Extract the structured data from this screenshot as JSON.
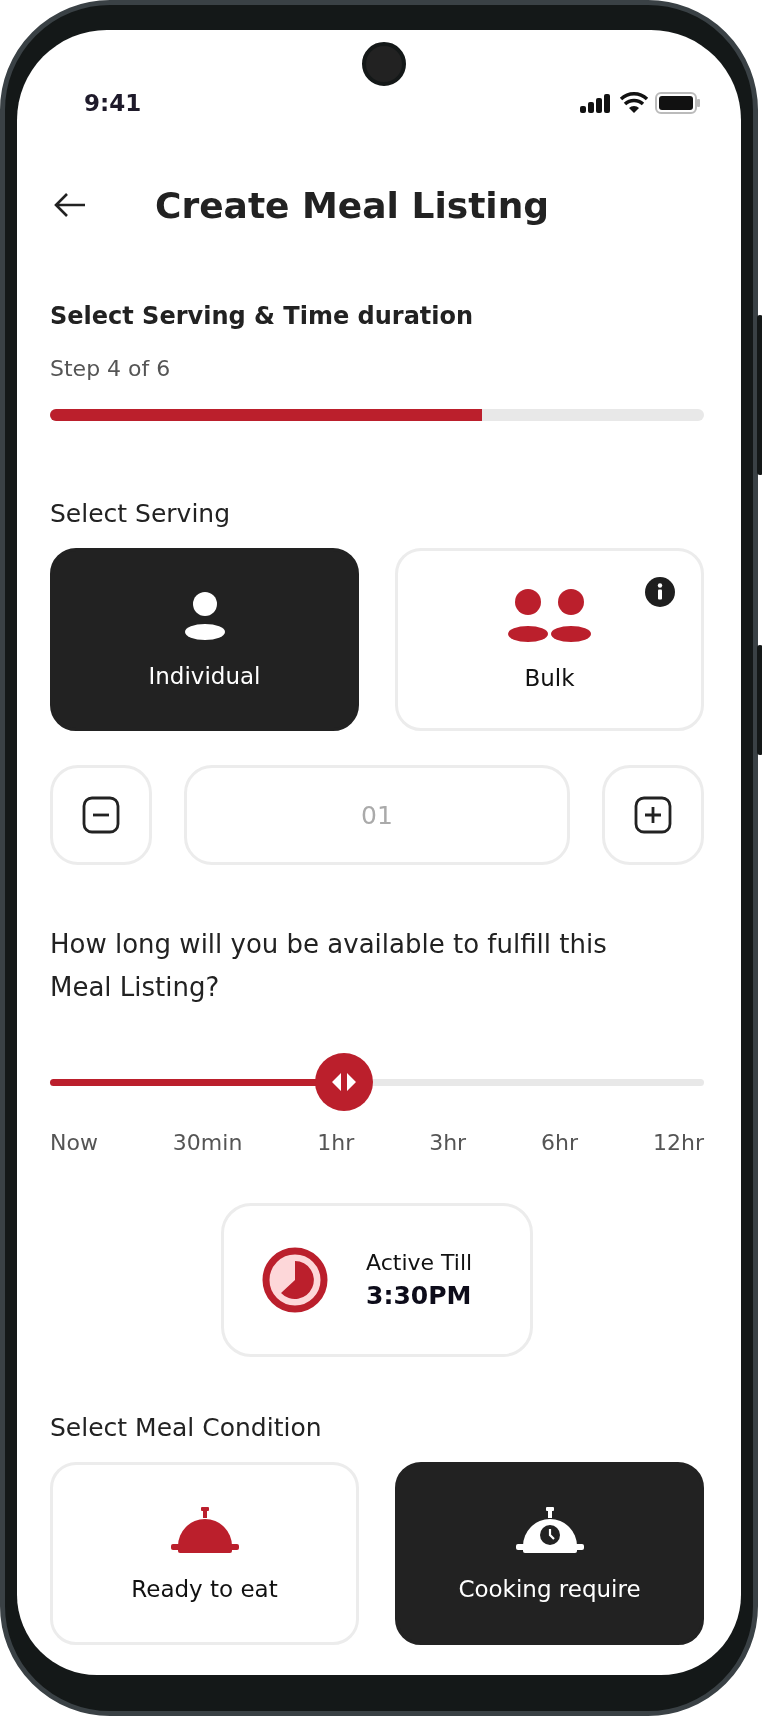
{
  "status_bar": {
    "time": "9:41"
  },
  "header": {
    "title": "Create Meal Listing"
  },
  "progress": {
    "title": "Select Serving & Time duration",
    "step": "Step 4 of 6",
    "level": 0.66
  },
  "serving": {
    "label": "Select Serving",
    "options": [
      {
        "kind": "individual",
        "label": "Individual",
        "selected": true,
        "info": false
      },
      {
        "kind": "bulk",
        "label": "Bulk",
        "selected": false,
        "info": true
      }
    ]
  },
  "quantity": {
    "value": "01"
  },
  "duration": {
    "question": "How long will you be available to fulfill this Meal Listing?",
    "level": 0.45,
    "ticks": [
      "Now",
      "30min",
      "1hr",
      "3hr",
      "6hr",
      "12hr"
    ]
  },
  "active_till": {
    "label": "Active Till",
    "time": "3:30PM"
  },
  "condition": {
    "label": "Select Meal Condition",
    "options": [
      {
        "kind": "ready",
        "label": "Ready to eat",
        "selected": false
      },
      {
        "kind": "cooking",
        "label": "Cooking require",
        "selected": true
      }
    ]
  }
}
